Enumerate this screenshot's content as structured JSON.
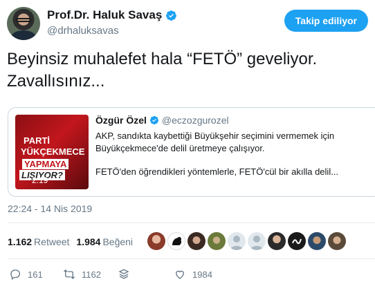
{
  "author": {
    "name": "Prof.Dr. Haluk Savaş",
    "handle": "@drhaluksavas",
    "follow_label": "Takip ediliyor"
  },
  "tweet": {
    "text_line1": "Beyinsiz muhalefet hala “FETÖ” geveliyor.",
    "text_line2": "Zavallısınız..."
  },
  "quoted": {
    "name": "Özgür Özel",
    "handle": "@eczozgurozel",
    "text_line1": "AKP, sandıkta kaybettiği Büyükşehir seçimini vermemek için",
    "text_line2": "Büyükçekmece'de delil üretmeye çalışıyor.",
    "text_line3": "FETÖ'den öğrendikleri yöntemlerle, FETÖ'cül bir akılla delil...",
    "video": {
      "line1": "PARTİ",
      "line2": "YÜKÇEKMECE",
      "line3": "YAPMAYA",
      "line4": "LIŞIYOR?",
      "duration": "2:19"
    }
  },
  "timestamp": "22:24 - 14 Nis 2019",
  "stats": {
    "retweets_count": "1.162",
    "retweets_label": "Retweet",
    "likes_count": "1.984",
    "likes_label": "Beğeni"
  },
  "actions": {
    "reply_count": "161",
    "retweet_count": "1162",
    "like_count": "1984"
  },
  "colors": {
    "accent": "#1da1f2",
    "secondary_text": "#657786",
    "border": "#ccd6dd"
  }
}
